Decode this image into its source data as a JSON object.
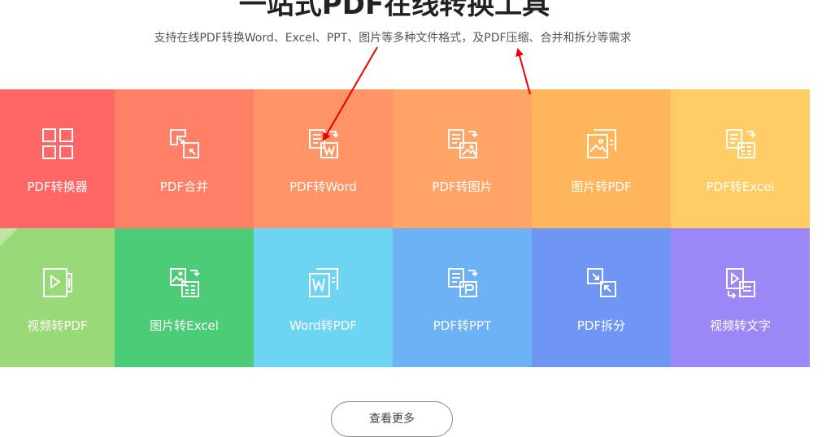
{
  "hero": {
    "title": "一站式PDF在线转换工具",
    "subtitle": "支持在线PDF转换Word、Excel、PPT、图片等多种文件格式，及PDF压缩、合并和拆分等需求"
  },
  "tools": [
    {
      "label": "PDF转换器",
      "icon": "grid-icon",
      "color": "#ff6666"
    },
    {
      "label": "PDF合并",
      "icon": "merge-icon",
      "color": "#ff8066"
    },
    {
      "label": "PDF转Word",
      "icon": "pdf-to-word-icon",
      "color": "#ff9466"
    },
    {
      "label": "PDF转图片",
      "icon": "pdf-to-image-icon",
      "color": "#ffa366"
    },
    {
      "label": "图片转PDF",
      "icon": "image-to-pdf-icon",
      "color": "#ffb55c"
    },
    {
      "label": "PDF转Excel",
      "icon": "pdf-to-excel-icon",
      "color": "#ffcc66"
    },
    {
      "label": "视频转PDF",
      "icon": "video-to-pdf-icon",
      "color": "#99d977"
    },
    {
      "label": "图片转Excel",
      "icon": "image-to-excel-icon",
      "color": "#4ccc77"
    },
    {
      "label": "Word转PDF",
      "icon": "word-to-pdf-icon",
      "color": "#6dd4f2"
    },
    {
      "label": "PDF转PPT",
      "icon": "pdf-to-ppt-icon",
      "color": "#6cb2f5"
    },
    {
      "label": "PDF拆分",
      "icon": "split-icon",
      "color": "#6f95f5"
    },
    {
      "label": "视频转文字",
      "icon": "video-to-text-icon",
      "color": "#9b87f5"
    }
  ],
  "more_button": {
    "label": "查看更多"
  },
  "annotation": {
    "arrow_color": "#ee0000"
  }
}
